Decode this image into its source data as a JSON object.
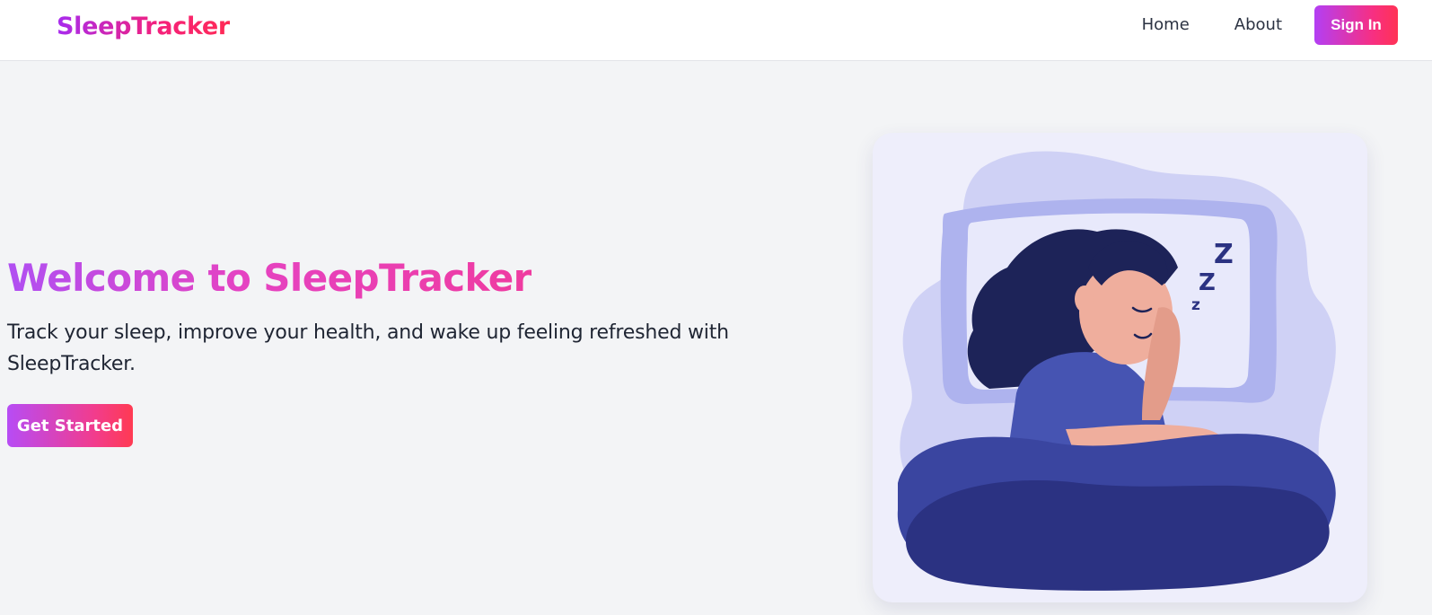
{
  "header": {
    "brand": "SleepTracker",
    "nav": {
      "home": "Home",
      "about": "About",
      "sign_in": "Sign In"
    }
  },
  "hero": {
    "title": "Welcome to SleepTracker",
    "description": "Track your sleep, improve your health, and wake up feeling refreshed with SleepTracker.",
    "cta": "Get Started"
  },
  "illustration": {
    "icon": "sleeping-woman-illustration"
  },
  "colors": {
    "gradient_start": "#a72bef",
    "gradient_end": "#ff2a55",
    "page_background": "#f3f4f6",
    "text_dark": "#1f2533",
    "blanket": "#2b3282"
  }
}
